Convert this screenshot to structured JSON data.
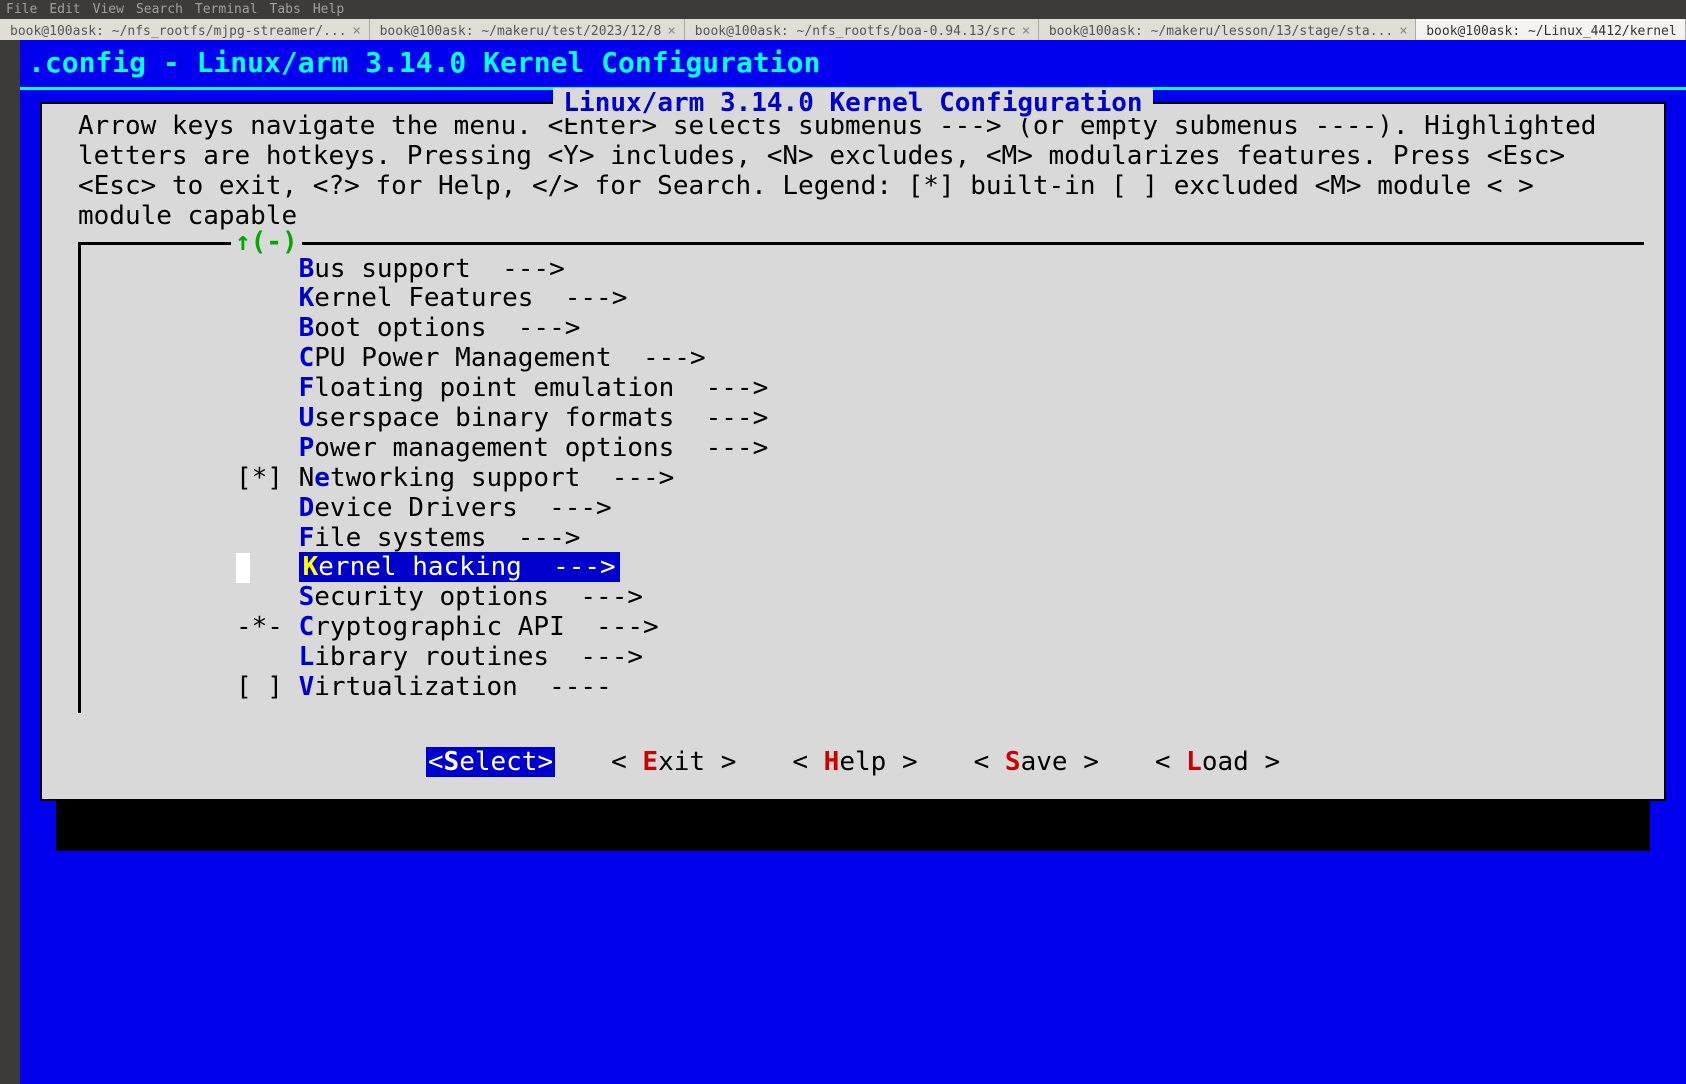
{
  "menubar": [
    "File",
    "Edit",
    "View",
    "Search",
    "Terminal",
    "Tabs",
    "Help"
  ],
  "tabs": [
    {
      "label": "book@100ask: ~/nfs_rootfs/mjpg-streamer/...",
      "active": false,
      "closable": true
    },
    {
      "label": "book@100ask: ~/makeru/test/2023/12/8",
      "active": false,
      "closable": true
    },
    {
      "label": "book@100ask: ~/nfs_rootfs/boa-0.94.13/src",
      "active": false,
      "closable": true
    },
    {
      "label": "book@100ask: ~/makeru/lesson/13/stage/sta...",
      "active": false,
      "closable": true
    },
    {
      "label": "book@100ask: ~/Linux_4412/kernel",
      "active": true,
      "closable": false
    }
  ],
  "title_line": " .config - Linux/arm 3.14.0 Kernel Configuration",
  "box_title": "Linux/arm 3.14.0 Kernel Configuration",
  "help_text": "Arrow keys navigate the menu.  <Enter> selects submenus ---> (or empty submenus ----).  Highlighted letters are hotkeys.  Pressing <Y> includes, <N> excludes, <M> modularizes features.  Press <Esc><Esc> to exit, <?> for Help, </> for Search.  Legend: [*] built-in  [ ] excluded  <M> module  < > module capable",
  "scroll_indicator": "↑(-)",
  "menu_items": [
    {
      "prefix": "    ",
      "hotkey": "B",
      "rest": "us support  --->",
      "selected": false
    },
    {
      "prefix": "    ",
      "hotkey": "K",
      "rest": "ernel Features  --->",
      "selected": false
    },
    {
      "prefix": "    ",
      "hotkey": "B",
      "rest": "oot options  --->",
      "selected": false
    },
    {
      "prefix": "    ",
      "hotkey": "C",
      "rest": "PU Power Management  --->",
      "selected": false
    },
    {
      "prefix": "    ",
      "hotkey": "F",
      "rest": "loating point emulation  --->",
      "selected": false
    },
    {
      "prefix": "    ",
      "hotkey": "U",
      "rest": "serspace binary formats  --->",
      "selected": false
    },
    {
      "prefix": "    ",
      "hotkey": "P",
      "rest": "ower management options  --->",
      "selected": false
    },
    {
      "prefix": "[*] ",
      "hotkey": "N",
      "rest": "etworking support  --->",
      "selected": false,
      "special_hotkey_pos": 1
    },
    {
      "prefix": "    ",
      "hotkey": "D",
      "rest": "evice Drivers  --->",
      "selected": false
    },
    {
      "prefix": "    ",
      "hotkey": "F",
      "rest": "ile systems  --->",
      "selected": false
    },
    {
      "prefix": "    ",
      "hotkey": "K",
      "rest": "ernel hacking  --->",
      "selected": true
    },
    {
      "prefix": "    ",
      "hotkey": "S",
      "rest": "ecurity options  --->",
      "selected": false
    },
    {
      "prefix": "-*- ",
      "hotkey": "C",
      "rest": "ryptographic API  --->",
      "selected": false
    },
    {
      "prefix": "    ",
      "hotkey": "L",
      "rest": "ibrary routines  --->",
      "selected": false
    },
    {
      "prefix": "[ ] ",
      "hotkey": "V",
      "rest": "irtualization  ----",
      "selected": false
    }
  ],
  "buttons": [
    {
      "pre": "<",
      "hot": "S",
      "post": "elect>",
      "selected": true
    },
    {
      "pre": "< ",
      "hot": "E",
      "post": "xit >",
      "selected": false
    },
    {
      "pre": "< ",
      "hot": "H",
      "post": "elp >",
      "selected": false
    },
    {
      "pre": "< ",
      "hot": "S",
      "post": "ave >",
      "selected": false
    },
    {
      "pre": "< ",
      "hot": "L",
      "post": "oad >",
      "selected": false
    }
  ]
}
